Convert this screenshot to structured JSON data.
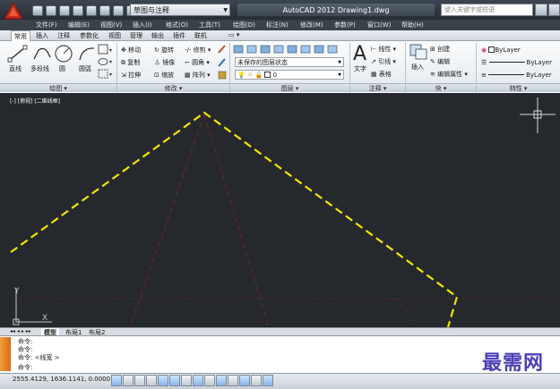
{
  "window": {
    "title": "AutoCAD 2012    Drawing1.dwg",
    "workspace": "草图与注释",
    "search_placeholder": "键入关键字或短语"
  },
  "menu": [
    "文件(F)",
    "编辑(E)",
    "视图(V)",
    "插入(I)",
    "格式(O)",
    "工具(T)",
    "绘图(D)",
    "标注(N)",
    "修改(M)",
    "参数(P)",
    "窗口(W)",
    "帮助(H)"
  ],
  "ribbon_tabs": [
    "常用",
    "插入",
    "注释",
    "参数化",
    "视图",
    "管理",
    "输出",
    "插件",
    "联机"
  ],
  "ribbon": {
    "draw": {
      "title": "绘图 ▾",
      "line": "直线",
      "polyline": "多段线",
      "circle": "圆",
      "arc": "圆弧"
    },
    "modify": {
      "title": "修改 ▾",
      "move": "移动",
      "rotate": "旋转",
      "trim": "修剪",
      "copy": "复制",
      "mirror": "镜像",
      "fillet": "圆角",
      "stretch": "拉伸",
      "scale": "缩放",
      "array": "阵列"
    },
    "layers": {
      "title": "图层 ▾",
      "state": "未保存的图层状态",
      "current_layer": "0"
    },
    "annotation": {
      "title": "注释 ▾",
      "text": "文字",
      "linear": "线性",
      "leader": "引线",
      "table": "表格"
    },
    "block": {
      "title": "块 ▾",
      "insert": "插入",
      "create": "创建",
      "edit": "编辑",
      "edit_attributes": "编辑属性"
    },
    "properties": {
      "title": "特性 ▾",
      "color": "ByLayer",
      "linetype": "ByLayer",
      "lineweight": "ByLayer"
    }
  },
  "viewport_label": "[-] [俯视] [二维线框]",
  "layout_tabs": [
    "模型",
    "布局1",
    "布局2"
  ],
  "command_lines": [
    "命令:",
    "命令:",
    "命令:  <线宽 >",
    "命令:"
  ],
  "status": {
    "coordinates": "2555.4129,  1636.1141,  0.0000"
  },
  "watermark": "最需网",
  "colors": {
    "canvas": "#25292e",
    "polyline": "#f2e600",
    "hidden_lines": "#8a2a2a",
    "ucs": "#c8c8c8"
  }
}
